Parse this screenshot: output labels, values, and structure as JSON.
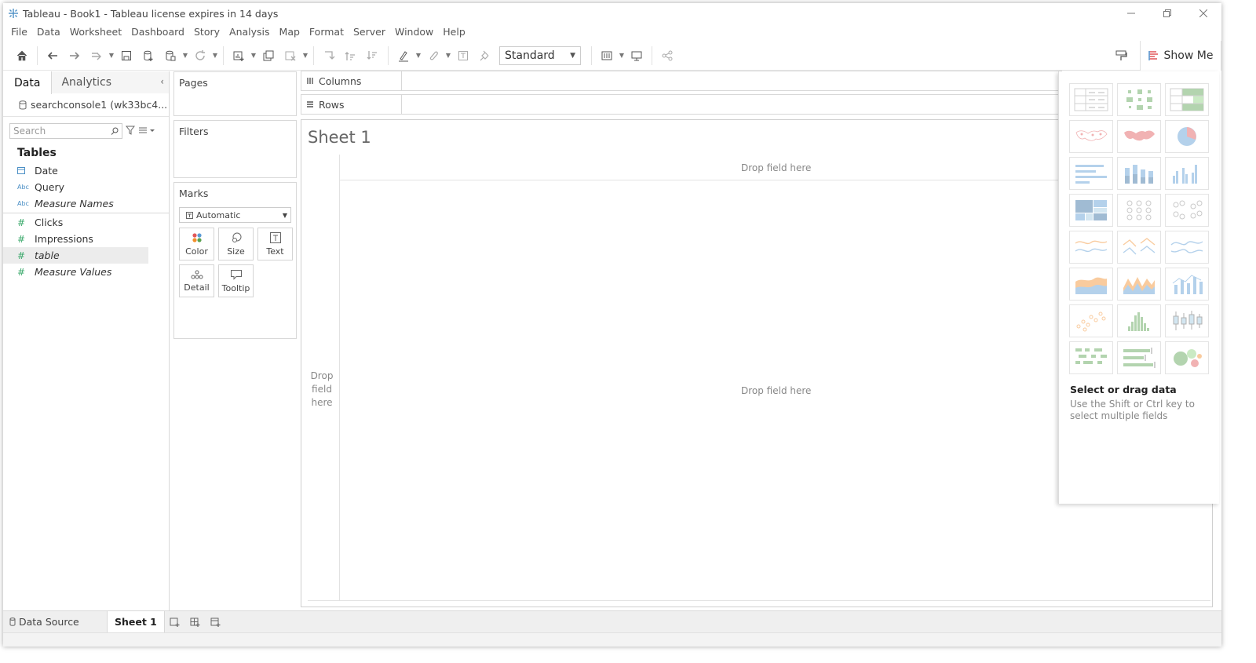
{
  "window": {
    "title": "Tableau - Book1 - Tableau license expires in 14 days"
  },
  "menu": [
    "File",
    "Data",
    "Worksheet",
    "Dashboard",
    "Story",
    "Analysis",
    "Map",
    "Format",
    "Server",
    "Window",
    "Help"
  ],
  "toolbar": {
    "fit_value": "Standard",
    "show_me_label": "Show Me"
  },
  "data_pane": {
    "tab_data": "Data",
    "tab_analytics": "Analytics",
    "datasource": "searchconsole1 (wk33bc4...",
    "search_placeholder": "Search",
    "tables_header": "Tables",
    "dimensions": [
      {
        "type": "date",
        "type_label": "",
        "name": "Date"
      },
      {
        "type": "string",
        "type_label": "Abc",
        "name": "Query"
      },
      {
        "type": "string",
        "type_label": "Abc",
        "name": "Measure Names"
      }
    ],
    "measures": [
      {
        "type_label": "#",
        "name": "Clicks"
      },
      {
        "type_label": "#",
        "name": "Impressions"
      },
      {
        "type_label": "#",
        "name": "table"
      },
      {
        "type_label": "#",
        "name": "Measure Values"
      }
    ]
  },
  "cards": {
    "pages": "Pages",
    "filters": "Filters",
    "marks": "Marks",
    "marks_type": "Automatic",
    "mark_buttons": {
      "color": "Color",
      "size": "Size",
      "text": "Text",
      "detail": "Detail",
      "tooltip": "Tooltip"
    }
  },
  "shelves": {
    "columns": "Columns",
    "rows": "Rows"
  },
  "view": {
    "sheet_title": "Sheet 1",
    "drop_top": "Drop field here",
    "drop_center": "Drop field here",
    "drop_left_lines": [
      "Drop",
      "field",
      "here"
    ]
  },
  "show_me": {
    "heading": "Select or drag data",
    "hint": "Use the Shift or Ctrl key to select multiple fields"
  },
  "bottom_tabs": {
    "data_source": "Data Source",
    "sheet": "Sheet 1"
  },
  "colors": {
    "accent_blue": "#4b8fc5",
    "measure_green": "#39a86a",
    "thumb_blue": "#5b9bd5",
    "thumb_orange": "#f28e2b",
    "thumb_green": "#59a14f",
    "thumb_red": "#e15759"
  }
}
